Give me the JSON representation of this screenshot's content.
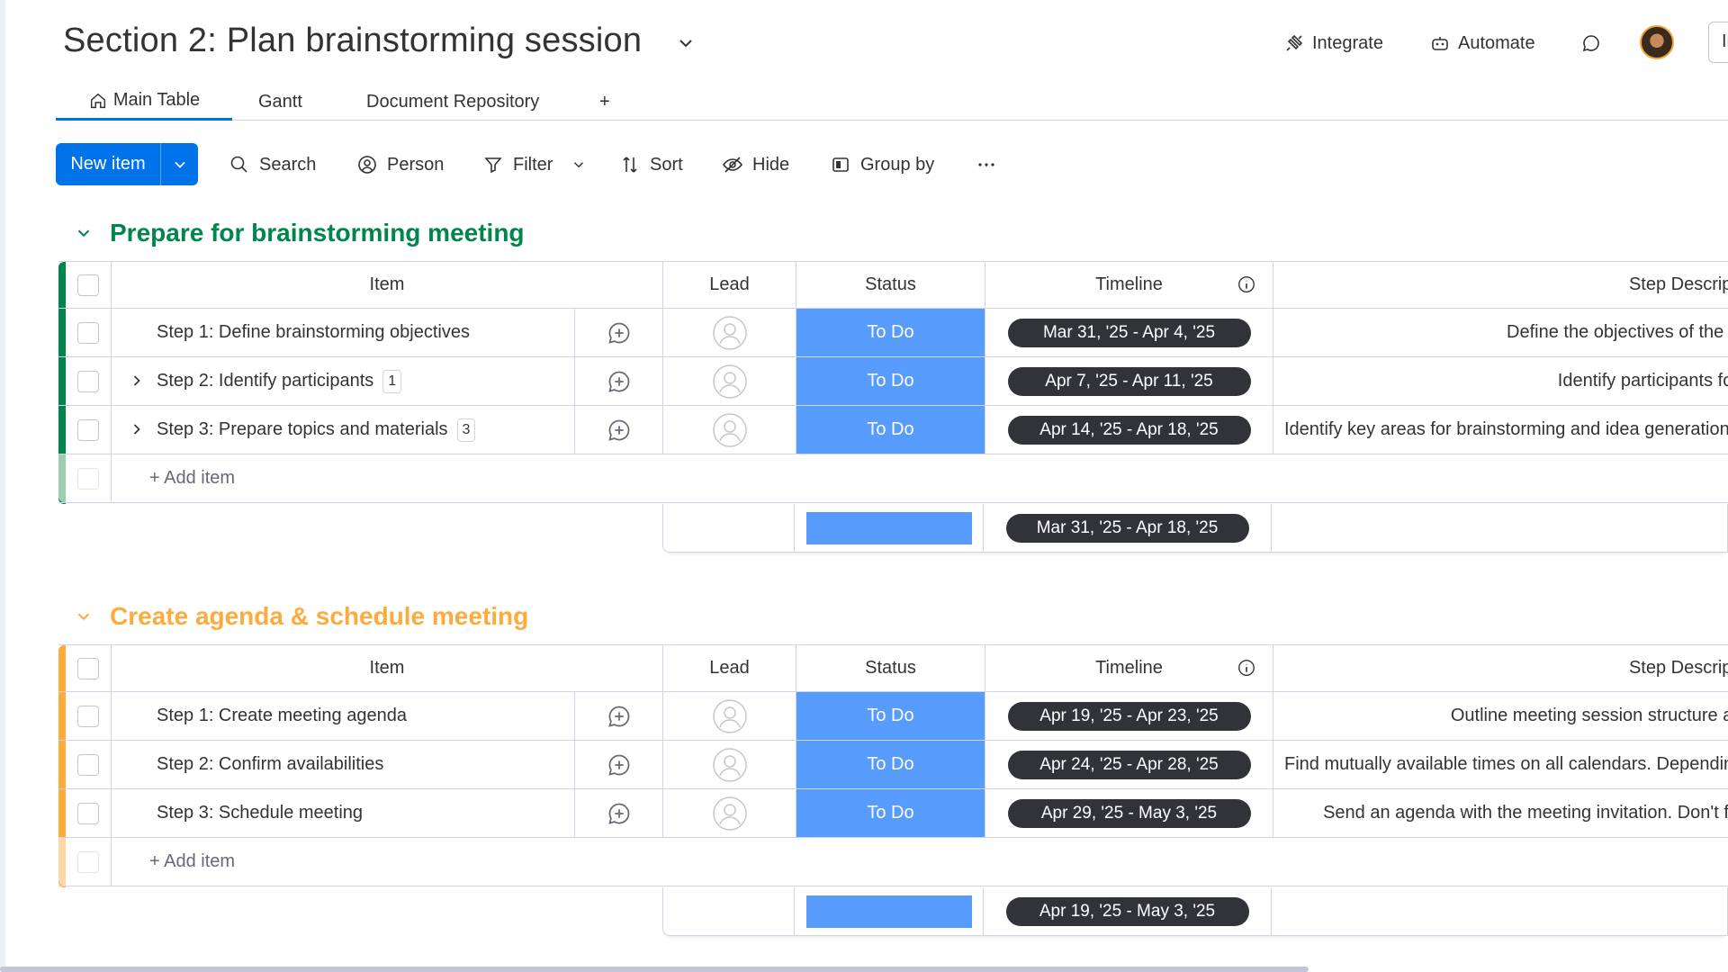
{
  "header": {
    "title": "Section 2: Plan brainstorming session",
    "integrate_label": "Integrate",
    "automate_label": "Automate",
    "invite_label": "Invite"
  },
  "tabs": [
    {
      "label": "Main Table",
      "active": true
    },
    {
      "label": "Gantt"
    },
    {
      "label": "Document Repository"
    },
    {
      "label": "+"
    }
  ],
  "toolbar": {
    "new_item_label": "New item",
    "search_label": "Search",
    "person_label": "Person",
    "filter_label": "Filter",
    "sort_label": "Sort",
    "hide_label": "Hide",
    "group_by_label": "Group by"
  },
  "columns": {
    "item": "Item",
    "lead": "Lead",
    "status": "Status",
    "timeline": "Timeline",
    "description": "Step Descript"
  },
  "groups": [
    {
      "title": "Prepare for brainstorming meeting",
      "color": "#00854d",
      "rows": [
        {
          "item": "Step 1: Define brainstorming objectives",
          "status": "To Do",
          "timeline": "Mar 31, '25 - Apr 4, '25",
          "description": "Define the objectives of the b"
        },
        {
          "item": "Step 2: Identify participants",
          "subitems": "1",
          "status": "To Do",
          "timeline": "Apr 7, '25 - Apr 11, '25",
          "description": "Identify participants for"
        },
        {
          "item": "Step 3: Prepare topics and materials",
          "subitems": "3",
          "status": "To Do",
          "timeline": "Apr 14, '25 - Apr 18, '25",
          "description": "Identify key areas for brainstorming and idea generation"
        }
      ],
      "add_item_label": "+ Add item",
      "summary_timeline": "Mar 31, '25 - Apr 18, '25"
    },
    {
      "title": "Create agenda & schedule meeting",
      "color": "#fdab3d",
      "rows": [
        {
          "item": "Step 1: Create meeting agenda",
          "status": "To Do",
          "timeline": "Apr 19, '25 - Apr 23, '25",
          "description": "Outline meeting session structure ar"
        },
        {
          "item": "Step 2: Confirm availabilities",
          "status": "To Do",
          "timeline": "Apr 24, '25 - Apr 28, '25",
          "description": "Find mutually available times on all calendars. Depending"
        },
        {
          "item": "Step 3: Schedule meeting",
          "status": "To Do",
          "timeline": "Apr 29, '25 - May 3, '25",
          "description": "Send an agenda with the meeting invitation. Don't fo"
        }
      ],
      "add_item_label": "+ Add item",
      "summary_timeline": "Apr 19, '25 - May 3, '25"
    }
  ]
}
